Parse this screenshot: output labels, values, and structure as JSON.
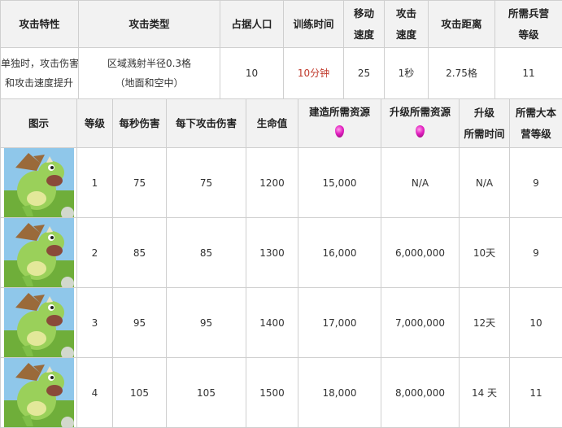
{
  "header": {
    "attack_trait": "攻击特性",
    "attack_type": "攻击类型",
    "housing": "占据人口",
    "training_time": "训练时间",
    "move_speed": [
      "移动",
      "速度"
    ],
    "attack_speed": [
      "攻击",
      "速度"
    ],
    "attack_range": "攻击距离",
    "required_barracks": [
      "所需兵营",
      "等级"
    ]
  },
  "info": {
    "attack_trait": [
      "单独时，攻击伤害",
      "和攻击速度提升"
    ],
    "attack_type": [
      "区域溅射半径0.3格",
      "（地面和空中）"
    ],
    "housing": "10",
    "training_time": "10分钟",
    "move_speed": "25",
    "attack_speed": "1秒",
    "attack_range": "2.75格",
    "required_barracks": "11"
  },
  "colors": {
    "highlight_red": "#c0392b",
    "header_bg": "#f2f2f2",
    "border": "#cfcfcf",
    "gem": "#e21fc0"
  },
  "levels_header": {
    "image": "图示",
    "level": "等级",
    "dps": "每秒伤害",
    "damage_per_hit": "每下攻击伤害",
    "hitpoints": "生命值",
    "build_cost": "建造所需资源",
    "upgrade_cost": "升级所需资源",
    "upgrade_time": [
      "升级",
      "所需时间"
    ],
    "required_town_hall": [
      "所需大本",
      "营等级"
    ],
    "resource_icon": "elixir-drop-icon"
  },
  "levels": [
    {
      "level": "1",
      "dps": "75",
      "damage_per_hit": "75",
      "hitpoints": "1200",
      "build_cost": "15,000",
      "upgrade_cost": "N/A",
      "upgrade_time": "N/A",
      "town_hall": "9"
    },
    {
      "level": "2",
      "dps": "85",
      "damage_per_hit": "85",
      "hitpoints": "1300",
      "build_cost": "16,000",
      "upgrade_cost": "6,000,000",
      "upgrade_time": "10天",
      "town_hall": "9"
    },
    {
      "level": "3",
      "dps": "95",
      "damage_per_hit": "95",
      "hitpoints": "1400",
      "build_cost": "17,000",
      "upgrade_cost": "7,000,000",
      "upgrade_time": "12天",
      "town_hall": "10"
    },
    {
      "level": "4",
      "dps": "105",
      "damage_per_hit": "105",
      "hitpoints": "1500",
      "build_cost": "18,000",
      "upgrade_cost": "8,000,000",
      "upgrade_time": "14 天",
      "town_hall": "11"
    }
  ]
}
